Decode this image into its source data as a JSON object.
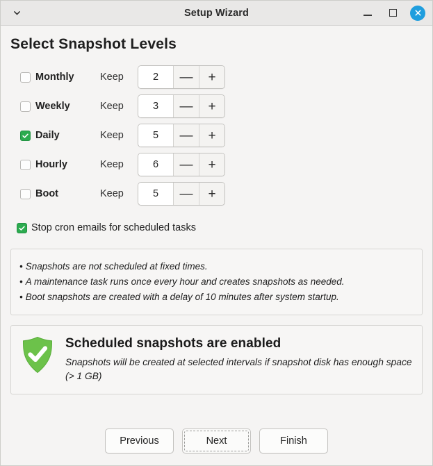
{
  "window": {
    "title": "Setup Wizard",
    "menu_icon": "chevron-down-icon",
    "minimize_label": "Minimize",
    "maximize_label": "Maximize",
    "close_label": "Close",
    "accent_close_color": "#1f9ede"
  },
  "page": {
    "title": "Select Snapshot Levels",
    "keep_label": "Keep",
    "minus_label": "—",
    "plus_label": "+",
    "check_color": "#2cab4f"
  },
  "levels": [
    {
      "name": "Monthly",
      "checked": false,
      "keep": "2"
    },
    {
      "name": "Weekly",
      "checked": false,
      "keep": "3"
    },
    {
      "name": "Daily",
      "checked": true,
      "keep": "5"
    },
    {
      "name": "Hourly",
      "checked": false,
      "keep": "6"
    },
    {
      "name": "Boot",
      "checked": false,
      "keep": "5"
    }
  ],
  "cron": {
    "label": "Stop cron emails for scheduled tasks",
    "checked": true
  },
  "info": {
    "bullet": "•",
    "lines": [
      "Snapshots are not scheduled at fixed times.",
      "A maintenance task runs once every hour and creates snapshots as needed.",
      "Boot snapshots are created with a delay of 10 minutes after system startup."
    ]
  },
  "status": {
    "icon": "shield-check-icon",
    "icon_color": "#6cc24a",
    "title": "Scheduled snapshots are enabled",
    "subtitle": "Snapshots will be created at selected intervals if snapshot disk has enough space (> 1 GB)"
  },
  "footer": {
    "previous": "Previous",
    "next": "Next",
    "finish": "Finish"
  }
}
